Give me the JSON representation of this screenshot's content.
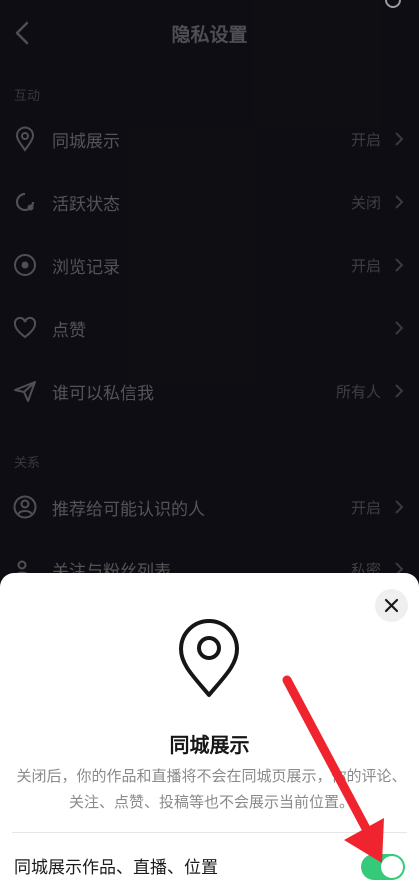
{
  "header": {
    "title": "隐私设置"
  },
  "sections": {
    "interaction": "互动",
    "relations": "关系"
  },
  "rows": [
    {
      "label": "同城展示",
      "value": "开启",
      "icon": "location-pin-icon"
    },
    {
      "label": "活跃状态",
      "value": "关闭",
      "icon": "activity-status-icon"
    },
    {
      "label": "浏览记录",
      "value": "开启",
      "icon": "eye-icon"
    },
    {
      "label": "点赞",
      "value": "",
      "icon": "heart-icon"
    },
    {
      "label": "谁可以私信我",
      "value": "所有人",
      "icon": "send-icon"
    },
    {
      "label": "推荐给可能认识的人",
      "value": "开启",
      "icon": "person-icon"
    },
    {
      "label": "关注与粉丝列表",
      "value": "私密",
      "icon": "people-icon"
    }
  ],
  "sheet": {
    "title": "同城展示",
    "description": "关闭后，你的作品和直播将不会在同城页展示，你的评论、关注、点赞、投稿等也不会展示当前位置。",
    "toggle_label": "同城展示作品、直播、位置",
    "toggle_on": true,
    "icon": "location-pin-icon",
    "close_icon": "close-icon"
  },
  "colors": {
    "toggle_on": "#35c97a",
    "annotation_arrow": "#f0242e"
  }
}
